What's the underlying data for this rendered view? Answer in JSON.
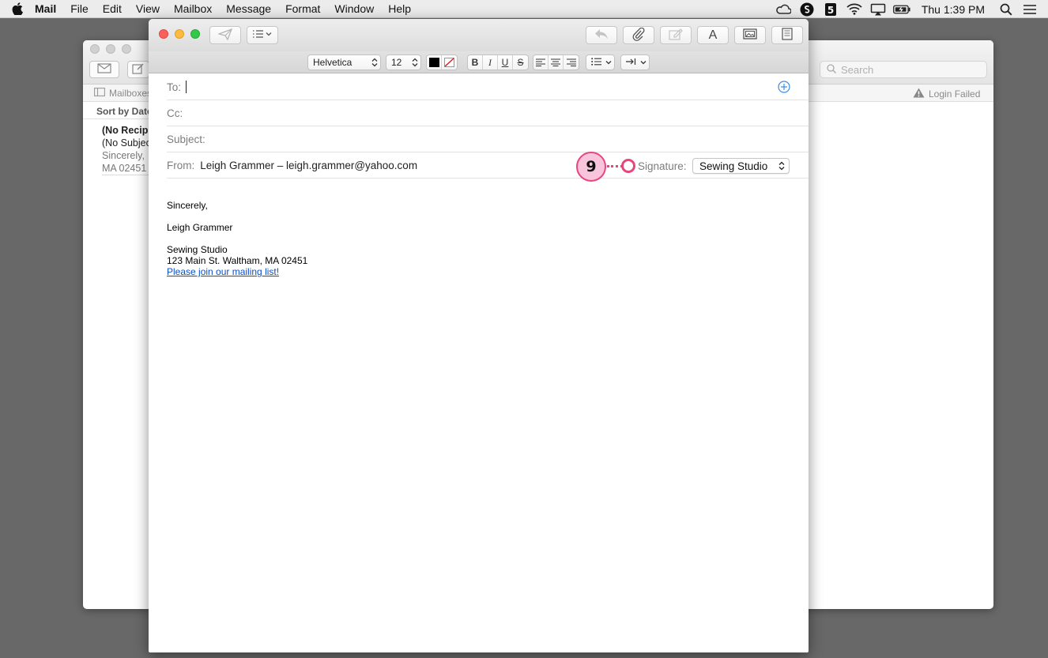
{
  "menubar": {
    "apple_icon": "apple-icon",
    "items": [
      "Mail",
      "File",
      "Edit",
      "View",
      "Mailbox",
      "Message",
      "Format",
      "Window",
      "Help"
    ],
    "clock": "Thu 1:39 PM",
    "status_icons": [
      "creative-cloud-icon",
      "sync-icon",
      "s5-icon",
      "wifi-icon",
      "airplay-icon",
      "battery-icon",
      "search-icon",
      "list-icon"
    ]
  },
  "main_window": {
    "search_placeholder": "Search",
    "mailboxes_label": "Mailboxes",
    "login_status": "Login Failed",
    "sort_label": "Sort by Date",
    "message": {
      "recipient": "(No Recipients)",
      "subject": "(No Subject)",
      "preview_line1": "Sincerely,",
      "preview_line2": "MA 02451"
    }
  },
  "compose": {
    "format": {
      "font": "Helvetica",
      "size": "12",
      "bold": "B",
      "italic": "I",
      "underline": "U",
      "strike": "S"
    },
    "to_label": "To:",
    "to_value": "",
    "cc_label": "Cc:",
    "subject_label": "Subject:",
    "from_label": "From:",
    "from_value": "Leigh Grammer – leigh.grammer@yahoo.com",
    "signature_label": "Signature:",
    "signature_value": "Sewing Studio",
    "font_button": "A",
    "callout_number": "9",
    "body": {
      "line1": "Sincerely,",
      "line2": "Leigh Grammer",
      "line3": "Sewing Studio",
      "line4": "123 Main St. Waltham, MA 02451",
      "link": "Please join our mailing list!"
    }
  }
}
